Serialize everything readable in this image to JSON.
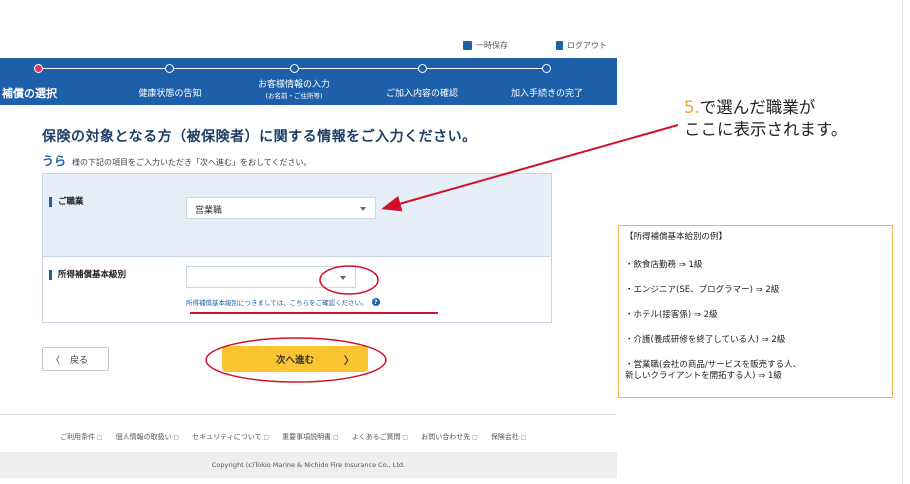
{
  "utility": {
    "save_label": "一時保存",
    "logout_label": "ログアウト"
  },
  "steps": [
    {
      "label": "補償の選択",
      "sub": ""
    },
    {
      "label": "健康状態の告知",
      "sub": ""
    },
    {
      "label": "お客様情報の入力",
      "sub": "(お名前・ご住所等)"
    },
    {
      "label": "ご加入内容の確認",
      "sub": ""
    },
    {
      "label": "加入手続きの完了",
      "sub": ""
    }
  ],
  "page": {
    "title": "保険の対象となる方（被保険者）に関する情報をご入力ください。",
    "person_name": "うら",
    "instruction": "様の下記の項目をご入力いただき「次へ進む」をおしてください。"
  },
  "form": {
    "occupation_label": "ご職業",
    "occupation_value": "営業職",
    "benefit_label": "所得補償基本級別",
    "benefit_value": "",
    "benefit_hint": "所得補償基本級別につきましては、こちらをご確認ください。"
  },
  "buttons": {
    "back": "戻る",
    "back_arrow": "〈",
    "next": "次へ進む",
    "next_arrow": "〉"
  },
  "footer": {
    "links": [
      "ご利用条件",
      "個人情報の取扱い",
      "セキュリティについて",
      "重要事項説明書",
      "よくあるご質問",
      "お問い合わせ先",
      "保険会社"
    ],
    "copyright": "Copyright (c)Tokio Marine & Nichido Fire Insurance Co., Ltd."
  },
  "callout": {
    "number": "5.",
    "line1": "で選んだ職業が",
    "line2": "ここに表示されます。"
  },
  "example_box": {
    "title": "【所得補償基本給別の例】",
    "items": [
      "・飲食店勤務 ⇒ 1級",
      "・エンジニア(SE、プログラマー) ⇒ 2級",
      "・ホテル(接客係) ⇒ 2級",
      "・介護(養成研修を終了している人) ⇒ 2級",
      "・営業職(会社の商品/サービスを販売する人、",
      "新しいクライアントを開拓する人) ⇒ 1級"
    ]
  },
  "colors": {
    "primary": "#1d5fa9",
    "accent": "#fbc531",
    "annotation": "#d0112b",
    "callout_num": "#f0a32e"
  }
}
